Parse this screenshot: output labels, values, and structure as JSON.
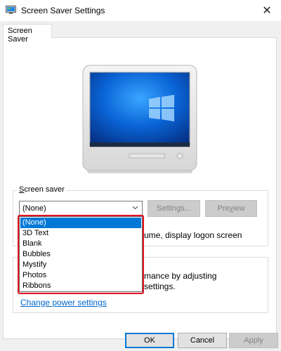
{
  "window": {
    "title": "Screen Saver Settings",
    "close_glyph": "✕",
    "icon": "screen-saver-settings-icon"
  },
  "tabs": [
    {
      "label": "Screen Saver",
      "selected": true
    }
  ],
  "screen_saver": {
    "group_label_prefix": "",
    "group_label_accel": "S",
    "group_label_rest": "creen saver",
    "selected_value": "(None)",
    "settings_label": "Settings...",
    "settings_enabled": false,
    "preview_label_pre": "Pre",
    "preview_label_accel": "v",
    "preview_label_post": "iew",
    "preview_enabled": false,
    "resume_text": "ume, display logon screen",
    "options": [
      "(None)",
      "3D Text",
      "Blank",
      "Bubbles",
      "Mystify",
      "Photos",
      "Ribbons"
    ],
    "selected_index": 0
  },
  "power": {
    "text_line1": "mance by adjusting",
    "text_line2": "settings.",
    "link": "Change power settings"
  },
  "footer": {
    "ok": "OK",
    "cancel": "Cancel",
    "apply": "Apply",
    "apply_enabled": false
  },
  "colors": {
    "accent": "#0078d7",
    "highlight_border": "#e81123",
    "link": "#0066cc"
  }
}
